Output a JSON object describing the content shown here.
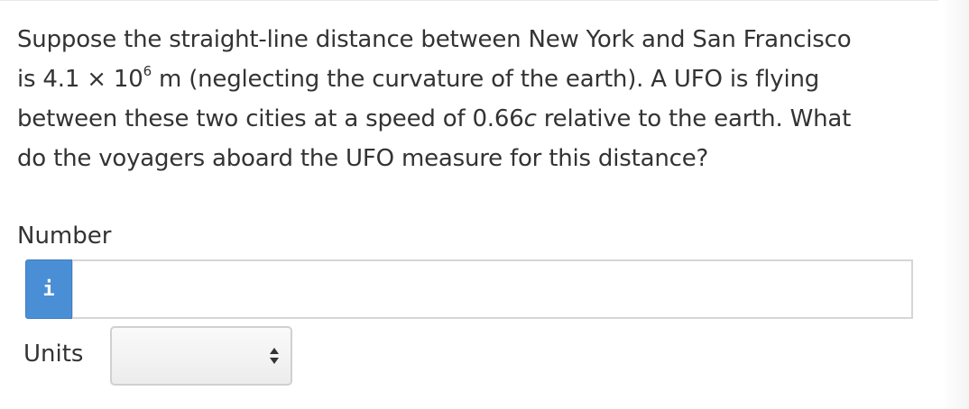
{
  "question": {
    "line1": "Suppose the straight-line distance between New York and San Francisco",
    "line2_prefix": "is 4.1 × 10",
    "line2_exponent": "6",
    "line2_suffix": " m (neglecting the curvature of the earth). A UFO is flying",
    "line3_prefix": "between these two cities at a speed of 0.66",
    "line3_italic": "c",
    "line3_suffix": " relative to the earth. What",
    "line4": "do the voyagers aboard the UFO measure for this distance?"
  },
  "answer": {
    "number_label": "Number",
    "info_icon_glyph": "i",
    "number_value": "",
    "units_label": "Units",
    "units_selected": ""
  },
  "colors": {
    "info_button": "#4a8fd6",
    "text": "#333333",
    "input_border": "#d6d6d6"
  },
  "icons": {
    "info": "info-icon",
    "select_arrows": "up-down-arrows-icon"
  }
}
